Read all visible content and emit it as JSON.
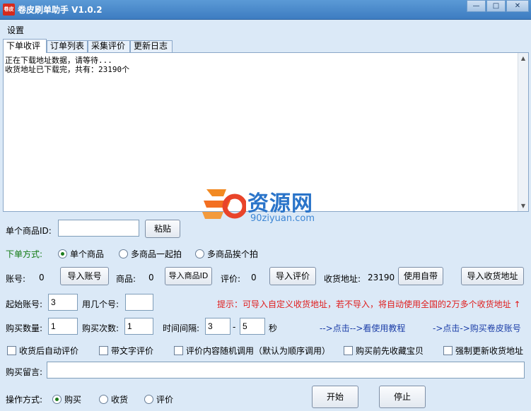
{
  "window": {
    "title": "卷皮刷单助手 V1.0.2",
    "icon_text": "卷皮",
    "min": "—",
    "max": "□",
    "close": "✕"
  },
  "menu": {
    "settings": "设置"
  },
  "tabs": [
    "下单收评",
    "订单列表",
    "采集评价",
    "更新日志"
  ],
  "log": {
    "lines": [
      "正在下载地址数据，请等待...",
      "收货地址已下载完，共有：23190个"
    ],
    "scroll_up": "▲",
    "scroll_down": "▼"
  },
  "watermark": {
    "main": "资源网",
    "sub": "90ziyuan.com"
  },
  "product": {
    "label": "单个商品ID:",
    "value": "",
    "paste_button": "粘贴"
  },
  "order_mode": {
    "label": "下单方式:",
    "options": [
      "单个商品",
      "多商品一起拍",
      "多商品挨个拍"
    ],
    "selected": 0
  },
  "stats": {
    "account_label": "账号:",
    "account_count": "0",
    "import_account": "导入账号",
    "goods_label": "商品:",
    "goods_count": "0",
    "import_goods": "导入商品ID",
    "review_label": "评价:",
    "review_count": "0",
    "import_review": "导入评价",
    "address_label": "收货地址:",
    "address_count": "23190",
    "use_builtin": "使用自带",
    "import_address": "导入收货地址"
  },
  "start": {
    "start_account_label": "起始账号:",
    "start_account": "3",
    "use_count_label": "用几个号:",
    "use_count": "",
    "tip": "提示：可导入自定义收货地址，若不导入，将自动使用全国的2万多个收货地址 ↑"
  },
  "buy": {
    "qty_label": "购买数量:",
    "qty": "1",
    "times_label": "购买次数:",
    "times": "1",
    "interval_label": "时间间隔:",
    "interval_min": "3",
    "dash": "-",
    "interval_max": "5",
    "unit": "秒",
    "tutorial_link": "-->点击-->看使用教程",
    "buy_account_link": "->点击->购买卷皮账号"
  },
  "options": [
    "收货后自动评价",
    "带文字评价",
    "评价内容随机调用（默认为顺序调用）",
    "购买前先收藏宝贝",
    "强制更新收货地址"
  ],
  "message": {
    "label": "购买留言:",
    "value": ""
  },
  "operation": {
    "label": "操作方式:",
    "options": [
      "购买",
      "收货",
      "评价"
    ],
    "selected": 0,
    "start_button": "开始",
    "stop_button": "停止"
  }
}
